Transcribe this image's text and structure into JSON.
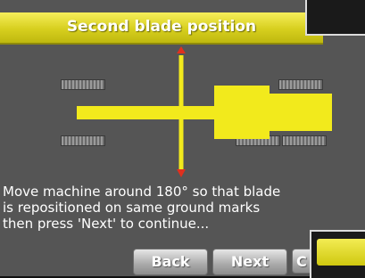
{
  "dialog": {
    "title": "Second blade position",
    "instruction": "Move machine around 180° so that blade\nis repositioned on same ground marks\nthen press 'Next' to continue...",
    "buttons": {
      "back_label": "Back",
      "next_label": "Next",
      "third_label": "C"
    }
  },
  "colors": {
    "accent": "#f2ea1c",
    "background": "#555555",
    "button": "#a9a9a9"
  }
}
